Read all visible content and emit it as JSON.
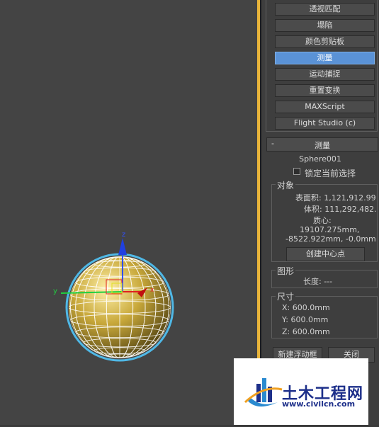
{
  "utilities": {
    "buttons": [
      {
        "label": "透视匹配"
      },
      {
        "label": "塌陷"
      },
      {
        "label": "颜色剪贴板"
      },
      {
        "label": "测量",
        "active": true
      },
      {
        "label": "运动捕捉"
      },
      {
        "label": "重置变换"
      },
      {
        "label": "MAXScript"
      },
      {
        "label": "Flight Studio (c)"
      }
    ]
  },
  "measure": {
    "rollout_toggle": "-",
    "rollout_title": "测量",
    "object_name": "Sphere001",
    "lock_selection_label": "锁定当前选择",
    "lock_selection_checked": false,
    "objects_group": {
      "label": "对象",
      "surface_area": "表面积: 1,121,912.99",
      "volume": "体积: 111,292,482.",
      "center_of_mass_label": "质心:",
      "center_line1": "19107.275mm,",
      "center_line2": "-8522.922mm, -0.0mm",
      "create_center_button": "创建中心点"
    },
    "shapes_group": {
      "label": "图形",
      "length": "长度: ---"
    },
    "dimensions_group": {
      "label": "尺寸",
      "x": "X:  600.0mm",
      "y": "Y:  600.0mm",
      "z": "Z:  600.0mm"
    },
    "new_floater_button": "新建浮动框",
    "close_button": "关闭"
  },
  "viewport": {
    "axis_z": "z",
    "axis_y": "y",
    "axis_x": "x"
  },
  "watermark": {
    "title": "土木工程网",
    "url": "www.civilcn.com"
  },
  "colors": {
    "accent_active": "#5a92d6",
    "panel_divider": "#e8b43a",
    "sphere_fill": "#b89a2a",
    "selection_outline": "#4fb8e6"
  }
}
